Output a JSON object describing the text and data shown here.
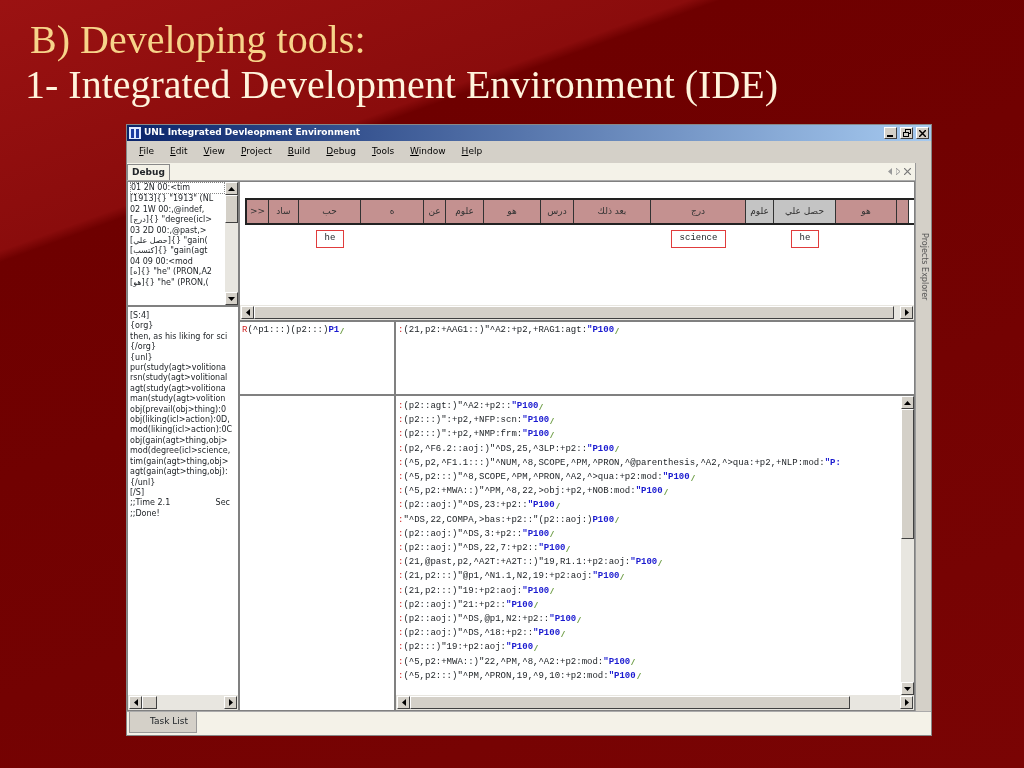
{
  "slide": {
    "title": "B) Developing tools:",
    "subtitle": "1- Integrated Development Environment (IDE)"
  },
  "window": {
    "title": "UNL Integrated Devleopment Environment"
  },
  "menu": [
    "File",
    "Edit",
    "View",
    "Project",
    "Build",
    "Debug",
    "Tools",
    "Window",
    "Help"
  ],
  "doc_tabs": [
    {
      "label": "Debug",
      "selected": true
    }
  ],
  "word_list": [
    "01  2N  00:<tim",
    "[1913]{}  \"1913\" (NL",
    "02  1W  00:,@indef,",
    "[درج]{}  \"degree(icl>",
    "03  2D  00:,@past,>",
    "[حصل علي]{}  \"gain(",
    "[كتسب]{}  \"gain(agt",
    "04  09  00:<mod",
    "[ه]{}  \"he\" (PRON,A2",
    "[هو]{}  \"he\" (PRON,("
  ],
  "sentence_log": [
    "[S:4]",
    "{org}",
    "then, as his liking for sci",
    "{/org}",
    "{unl}",
    "pur(study(agt>volitiona",
    "rsn(study(agt>volitional",
    "agt(study(agt>volitiona",
    "man(study(agt>volition",
    "obj(prevail(obj>thing):0",
    "obj(liking(icl>action):0D,",
    "mod(liking(icl>action):0C",
    "obj(gain(agt>thing,obj>",
    "mod(degree(icl>science,",
    "tim(gain(agt>thing,obj>",
    "agt(gain(agt>thing,obj):",
    "{/unl}",
    "[/S]",
    ";;Time  2.1",
    ";;Done!"
  ],
  "time_unit": "Sec",
  "tokens": [
    {
      "text": "هو",
      "highlighted": false
    },
    {
      "text": "حصل علي",
      "highlighted": true,
      "glossed": true
    },
    {
      "text": "علوم",
      "highlighted": true
    },
    {
      "text": "درج",
      "highlighted": false,
      "glossed": true
    },
    {
      "text": "بعد ذلك",
      "highlighted": false
    },
    {
      "text": "درس",
      "highlighted": false
    },
    {
      "text": "هو",
      "highlighted": false
    },
    {
      "text": "علوم",
      "highlighted": false
    },
    {
      "text": "عن",
      "highlighted": false
    },
    {
      "text": "ه",
      "highlighted": false
    },
    {
      "text": "حب",
      "highlighted": false,
      "glossed": true
    },
    {
      "text": "ساد",
      "highlighted": false
    },
    {
      "text": ">>",
      "highlighted": false
    }
  ],
  "glosses": [
    "he",
    "science",
    "he"
  ],
  "left_rule": {
    "head": "R",
    "body": "(^p1:::)(p2:::)",
    "tail": "P1"
  },
  "right_rule": {
    "head": ":",
    "body": "(21,p2:+AAG1::)\"^A2:+p2,+RAG1:agt:",
    "tail": "\"P100"
  },
  "rules": [
    {
      "head": ":",
      "body": "(p2::agt:)\"^A2:+p2::",
      "tail": "\"P100"
    },
    {
      "head": ":",
      "body": "(p2:::)\":+p2,+NFP:scn:",
      "tail": "\"P100"
    },
    {
      "head": ":",
      "body": "(p2:::)\":+p2,+NMP:frm:",
      "tail": "\"P100"
    },
    {
      "head": ":",
      "body": "(p2,^F6.2::aoj:)\"^DS,25,^3LP:+p2::",
      "tail": "\"P100"
    },
    {
      "head": ":",
      "body": "(^5,p2,^F1.1:::)\"^NUM,^8,SCOPE,^PM,^PRON,^@parenthesis,^A2,^>qua:+p2,+NLP:mod:",
      "tail": "\"P:"
    },
    {
      "head": ":",
      "body": "(^5,p2:::)\"^8,SCOPE,^PM,^PRON,^A2,^>qua:+p2:mod:",
      "tail": "\"P100"
    },
    {
      "head": ":",
      "body": "(^5,p2:+MWA::)\"^PM,^8,22,>obj:+p2,+NOB:mod:",
      "tail": "\"P100"
    },
    {
      "head": ":",
      "body": "(p2::aoj:)\"^DS,23:+p2::",
      "tail": "\"P100"
    },
    {
      "head": ":",
      "body": "\"^DS,22,COMPA,>bas:+p2::\"(p2::aoj:)",
      "tail": "P100"
    },
    {
      "head": ":",
      "body": "(p2::aoj:)\"^DS,3:+p2::",
      "tail": "\"P100"
    },
    {
      "head": ":",
      "body": "(p2::aoj:)\"^DS,22,7:+p2::",
      "tail": "\"P100"
    },
    {
      "head": ":",
      "body": "(21,@past,p2,^A2T:+A2T::)\"19,R1.1:+p2:aoj:",
      "tail": "\"P100"
    },
    {
      "head": ":",
      "body": "(21,p2:::)\"@p1,^N1.1,N2,19:+p2:aoj:",
      "tail": "\"P100"
    },
    {
      "head": ":",
      "body": "(21,p2:::)\"19:+p2:aoj:",
      "tail": "\"P100"
    },
    {
      "head": ":",
      "body": "(p2::aoj:)\"21:+p2::",
      "tail": "\"P100"
    },
    {
      "head": ":",
      "body": "(p2::aoj:)\"^DS,@p1,N2:+p2::",
      "tail": "\"P100"
    },
    {
      "head": ":",
      "body": "(p2::aoj:)\"^DS,^18:+p2::",
      "tail": "\"P100"
    },
    {
      "head": ":",
      "body": "(p2:::)\"19:+p2:aoj:",
      "tail": "\"P100"
    },
    {
      "head": ":",
      "body": "(^5,p2:+MWA::)\"22,^PM,^8,^A2:+p2:mod:",
      "tail": "\"P100"
    },
    {
      "head": ":",
      "body": "(^5,p2:::)\"^PM,^PRON,19,^9,10:+p2:mod:",
      "tail": "\"P100"
    }
  ],
  "side_panel": {
    "label": "Projects Explorer"
  },
  "bottom_tabs": [
    {
      "label": "Task List",
      "selected": true
    }
  ]
}
